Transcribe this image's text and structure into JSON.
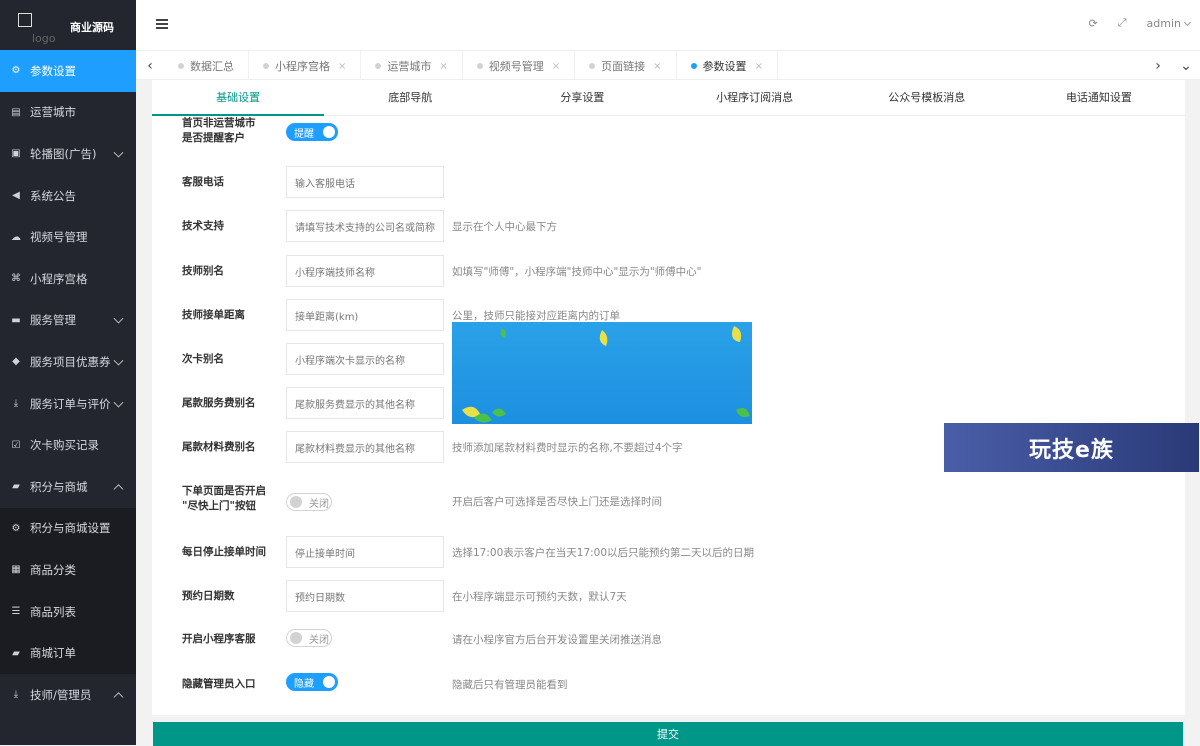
{
  "brand": {
    "logo_alt": "logo",
    "title": "商业源码"
  },
  "sidebar": {
    "items": [
      {
        "label": "参数设置",
        "icon": "gear-icon",
        "glyph": "⚙"
      },
      {
        "label": "运营城市",
        "icon": "document-icon",
        "glyph": "▤"
      },
      {
        "label": "轮播图(广告)",
        "icon": "image-icon",
        "glyph": "▣"
      },
      {
        "label": "系统公告",
        "icon": "speaker-icon",
        "glyph": "◀"
      },
      {
        "label": "视频号管理",
        "icon": "cloud-icon",
        "glyph": "☁"
      },
      {
        "label": "小程序宫格",
        "icon": "sitemap-icon",
        "glyph": "⌘"
      },
      {
        "label": "服务管理",
        "icon": "list-icon",
        "glyph": "▬"
      },
      {
        "label": "服务项目优惠券",
        "icon": "tag-icon",
        "glyph": "◆"
      },
      {
        "label": "服务订单与评价",
        "icon": "download-icon",
        "glyph": "⤓"
      },
      {
        "label": "次卡购买记录",
        "icon": "check-square-icon",
        "glyph": "☑"
      },
      {
        "label": "积分与商城",
        "icon": "cart-icon",
        "glyph": "▰"
      },
      {
        "label": "积分与商城设置",
        "icon": "gear-icon",
        "glyph": "⚙"
      },
      {
        "label": "商品分类",
        "icon": "grid-icon",
        "glyph": "▦"
      },
      {
        "label": "商品列表",
        "icon": "sliders-icon",
        "glyph": "☰"
      },
      {
        "label": "商城订单",
        "icon": "cart-icon",
        "glyph": "▰"
      },
      {
        "label": "技师/管理员",
        "icon": "download-icon",
        "glyph": "⤓"
      }
    ]
  },
  "header": {
    "admin_label": "admin",
    "refresh_glyph": "⟳",
    "fullscreen_glyph": "⤢"
  },
  "tabs": [
    {
      "label": "数据汇总"
    },
    {
      "label": "小程序宫格"
    },
    {
      "label": "运营城市"
    },
    {
      "label": "视频号管理"
    },
    {
      "label": "页面链接"
    },
    {
      "label": "参数设置"
    }
  ],
  "tab_close": "×",
  "subtabs": [
    "基础设置",
    "底部导航",
    "分享设置",
    "小程序订阅消息",
    "公众号模板消息",
    "电话通知设置"
  ],
  "form": {
    "remind_city": {
      "label_line1": "首页非运营城市",
      "label_line2": "是否提醒客户",
      "switch": "提醒"
    },
    "service_phone": {
      "label": "客服电话",
      "placeholder": "输入客服电话"
    },
    "tech_support": {
      "label": "技术支持",
      "placeholder": "请填写技术支持的公司名或简称",
      "hint": "显示在个人中心最下方"
    },
    "tech_alias": {
      "label": "技师别名",
      "placeholder": "小程序端技师名称",
      "hint": "如填写\"师傅\"，小程序端\"技师中心\"显示为\"师傅中心\""
    },
    "tech_distance": {
      "label": "技师接单距离",
      "placeholder": "接单距离(km)",
      "hint": "公里，技师只能接对应距离内的订单"
    },
    "card_alias": {
      "label": "次卡别名",
      "placeholder": "小程序端次卡显示的名称"
    },
    "balance_service": {
      "label": "尾款服务费别名",
      "placeholder": "尾款服务费显示的其他名称"
    },
    "balance_material": {
      "label": "尾款材料费别名",
      "placeholder": "尾款材料费显示的其他名称",
      "hint": "技师添加尾款材料费时显示的名称,不要超过4个字"
    },
    "asap_button": {
      "label_line1": "下单页面是否开启",
      "label_line2": "\"尽快上门\"按钮",
      "switch": "关闭",
      "hint": "开启后客户可选择是否尽快上门还是选择时间"
    },
    "stop_time": {
      "label": "每日停止接单时间",
      "placeholder": "停止接单时间",
      "hint": "选择17:00表示客户在当天17:00以后只能预约第二天以后的日期"
    },
    "booking_days": {
      "label": "预约日期数",
      "placeholder": "预约日期数",
      "hint": "在小程序端显示可预约天数，默认7天"
    },
    "mp_service": {
      "label": "开启小程序客服",
      "switch": "关闭",
      "hint": "请在小程序官方后台开发设置里关闭推送消息"
    },
    "hide_admin": {
      "label": "隐藏管理员入口",
      "switch": "隐藏",
      "hint": "隐藏后只有管理员能看到"
    }
  },
  "submit_label": "提交",
  "watermark_text": "玩技e族",
  "colors": {
    "sidebar_bg": "#23262e",
    "active_blue": "#1e9fff",
    "accent_green": "#009688"
  }
}
